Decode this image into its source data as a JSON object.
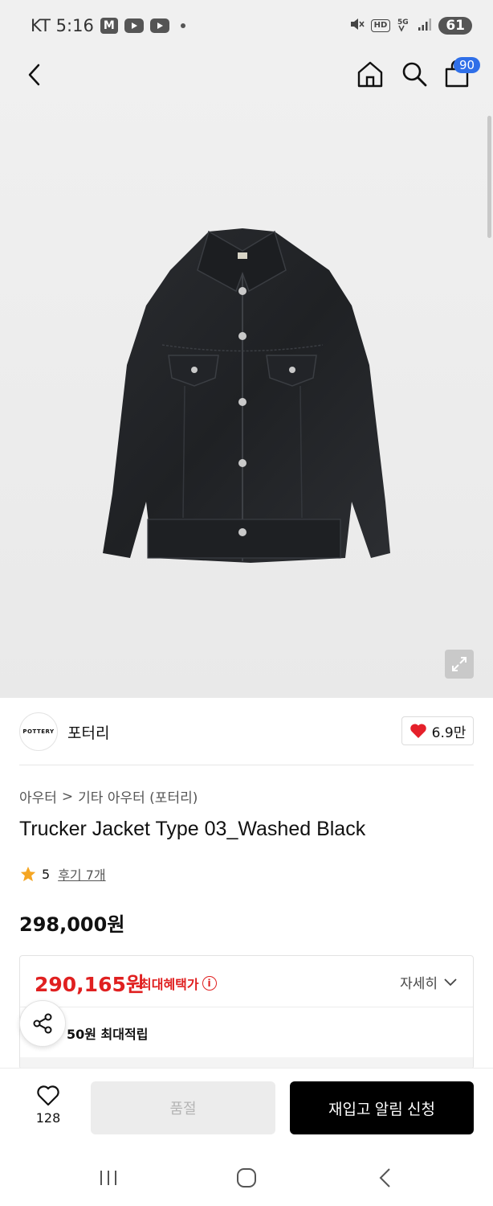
{
  "status_bar": {
    "carrier_time": "KT 5:16",
    "m_badge": "M",
    "hd": "HD",
    "battery": "61"
  },
  "header": {
    "cart_count": "90",
    "icons": [
      "back-arrow-icon",
      "home-icon",
      "search-icon",
      "cart-icon"
    ]
  },
  "brand": {
    "logo_text": "POTTERY",
    "name": "포터리",
    "like_count": "6.9만"
  },
  "breadcrumb": {
    "category": "아우터",
    "separator": ">",
    "subcategory": "기타 아우터 (포터리)"
  },
  "product": {
    "title": "Trucker Jacket Type 03_Washed Black",
    "rating": "5",
    "review_link": "후기 7개",
    "price": "298,000원"
  },
  "benefit": {
    "max_price": "290,165원",
    "max_label": "최대혜택가",
    "info_icon": "i",
    "detail_label": "자세히",
    "points": "50원 최대적립"
  },
  "bottom_bar": {
    "wish_count": "128",
    "soldout_label": "품절",
    "restock_label": "재입고 알림 신청"
  },
  "colors": {
    "accent_red": "#e02020",
    "badge_blue": "#2f6fe8",
    "primary_black": "#000000"
  }
}
